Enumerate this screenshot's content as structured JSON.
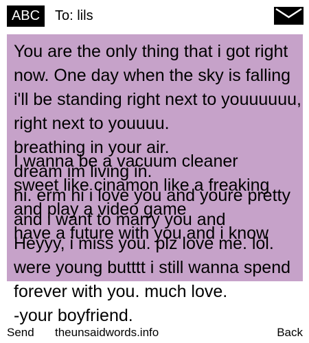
{
  "header": {
    "badge": "ABC",
    "to": "To: lils",
    "icon": "envelope-icon"
  },
  "message": {
    "layers": [
      "You are the only thing that i got right now. One day when the sky is falling i'll be standing right next to youuuuuu, right next to youuuu.\nbreathing in your air.\ndream im living in.\nhi. erm hi i love you and youre pretty and i want to marry you and",
      "I wanna be a vacuum cleaner\nsweet like cinamon like a freaking\nand play a video game\nhave a future with you and i know",
      "Heyyy, i miss you. plz love me. lol.\nwere young butttt i still wanna spend forever with you. much love.\n-your boyfriend."
    ]
  },
  "footer": {
    "send": "Send",
    "site": "theunsaidwords.info",
    "back": "Back"
  }
}
